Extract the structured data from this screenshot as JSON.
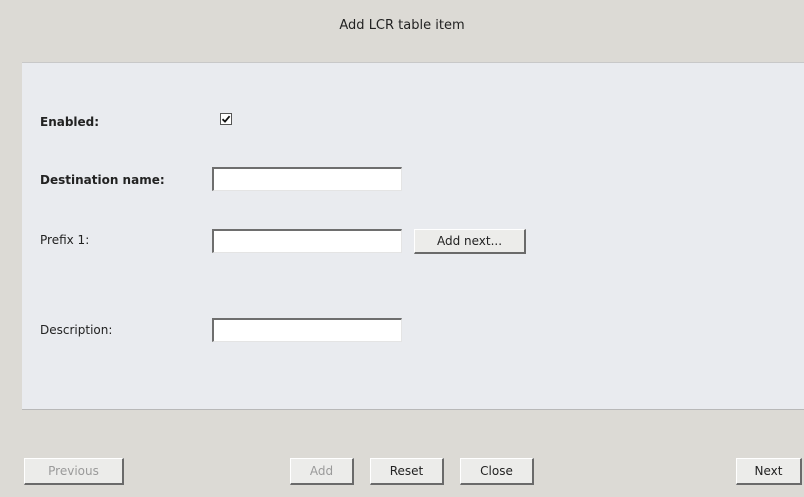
{
  "dialog": {
    "title": "Add LCR table item"
  },
  "form": {
    "enabled": {
      "label": "Enabled:",
      "checked": true
    },
    "destination_name": {
      "label": "Destination name:",
      "value": ""
    },
    "prefix": {
      "label": "Prefix 1:",
      "value": "",
      "add_next_label": "Add next..."
    },
    "description": {
      "label": "Description:",
      "value": ""
    }
  },
  "footer": {
    "previous_label": "Previous",
    "previous_disabled": true,
    "add_label": "Add",
    "add_disabled": true,
    "reset_label": "Reset",
    "close_label": "Close",
    "next_label": "Next"
  }
}
